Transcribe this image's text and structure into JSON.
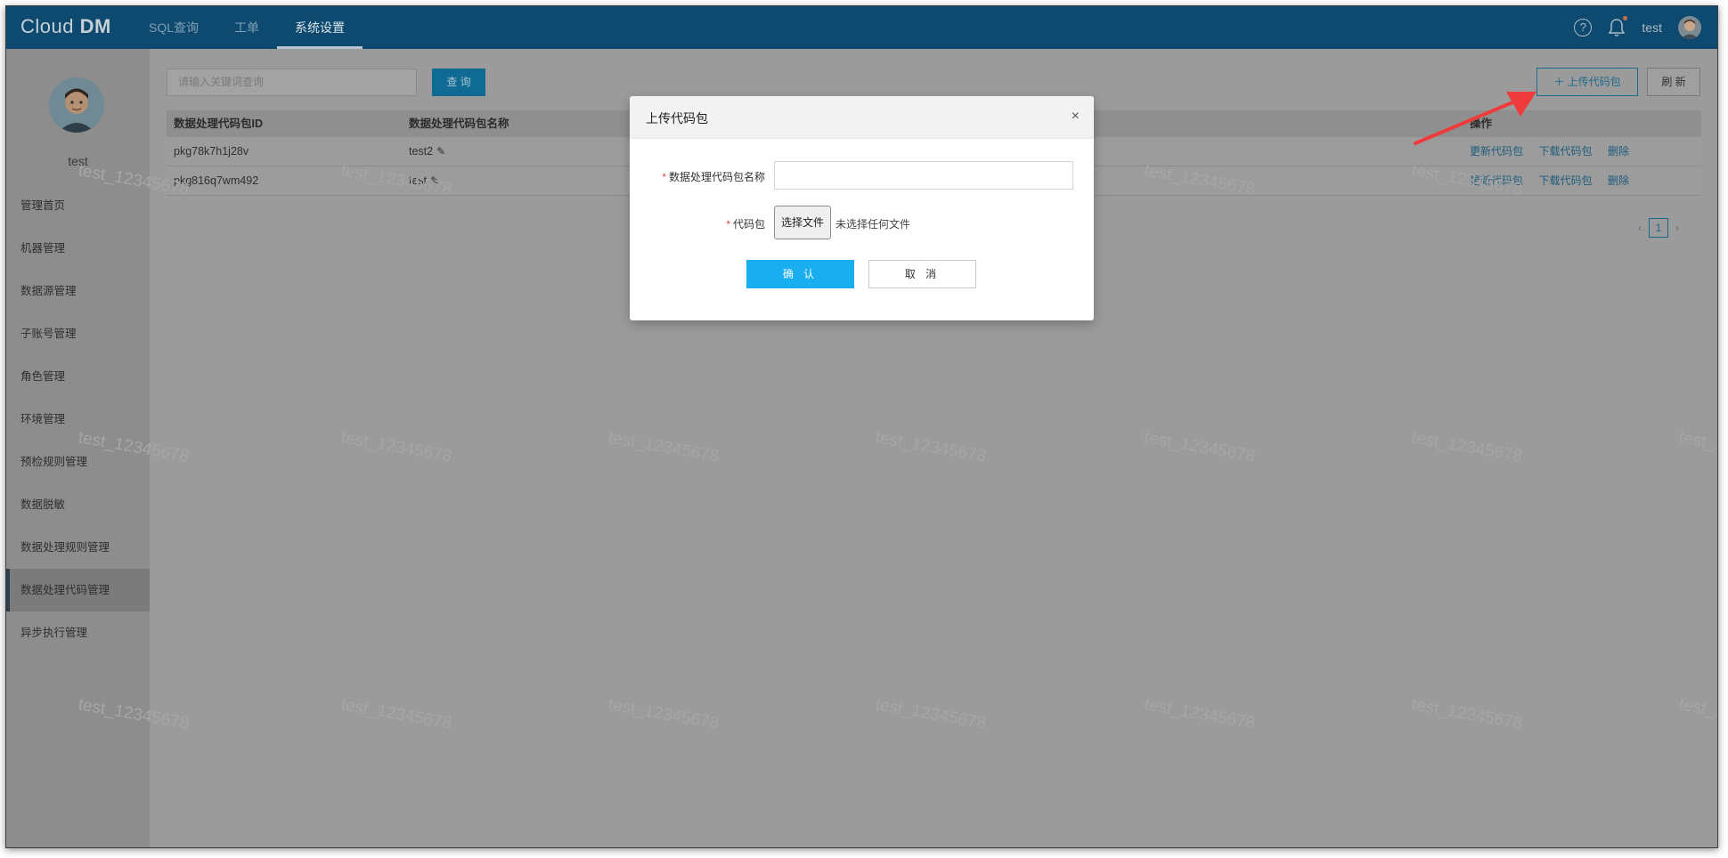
{
  "app": {
    "logo_text": "Cloud",
    "logo_bold": "DM"
  },
  "topnav": {
    "items": [
      "SQL查询",
      "工单",
      "系统设置"
    ],
    "active_index": 2
  },
  "header": {
    "help_icon": "?",
    "username": "test"
  },
  "sidebar": {
    "username": "test",
    "items": [
      "管理首页",
      "机器管理",
      "数据源管理",
      "子账号管理",
      "角色管理",
      "环境管理",
      "预检规则管理",
      "数据脱敏",
      "数据处理规则管理",
      "数据处理代码管理",
      "异步执行管理"
    ],
    "active_index": 9
  },
  "toolbar": {
    "search_placeholder": "请输入关键词查询",
    "query_label": "查 询",
    "upload_label": "＋ 上传代码包",
    "refresh_label": "刷 新"
  },
  "table": {
    "headers": [
      "数据处理代码包ID",
      "数据处理代码包名称",
      "操作"
    ],
    "rows": [
      {
        "id": "pkg78k7h1j28v",
        "name": "test2"
      },
      {
        "id": "pkg816q7wm492",
        "name": "test"
      }
    ],
    "actions": [
      "更新代码包",
      "下载代码包",
      "删除"
    ]
  },
  "pagination": {
    "prev": "‹",
    "page": "1",
    "next": "›"
  },
  "watermark": "test_12345678",
  "modal": {
    "title": "上传代码包",
    "close": "×",
    "required_mark": "*",
    "name_label": "数据处理代码包名称",
    "name_value": "",
    "package_label": "代码包",
    "choose_file_label": "选择文件",
    "file_status": "未选择任何文件",
    "confirm_label": "确 认",
    "cancel_label": "取 消"
  },
  "colors": {
    "topbar": "#0e4a6f",
    "primary": "#18aef0",
    "arrow": "#ef3b3b",
    "required": "#e24646"
  }
}
